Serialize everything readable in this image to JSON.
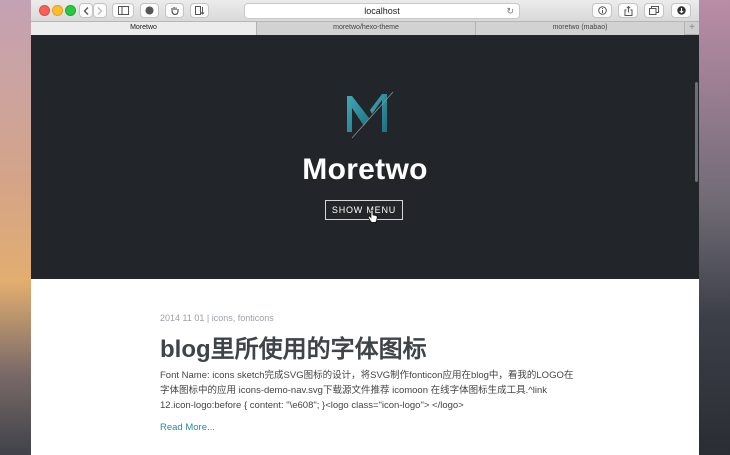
{
  "browser": {
    "address": "localhost",
    "tabs": [
      {
        "label": "Moretwo",
        "active": true
      },
      {
        "label": "moretwo/hexo-theme",
        "active": false
      },
      {
        "label": "moretwo (mabao)",
        "active": false
      }
    ],
    "new_tab_label": "+"
  },
  "hero": {
    "site_title": "Moretwo",
    "menu_button": "SHOW MENU",
    "background": "#222529",
    "accent": "#2a8a9a"
  },
  "post": {
    "date": "2014 11 01",
    "separator": "|",
    "tags": "icons, fonticons",
    "title": "blog里所使用的字体图标",
    "excerpt": "Font Name: icons sketch完成SVG图标的设计，将SVG制作fonticon应用在blog中，看我的LOGO在字体图标中的应用 icons-demo-nav.svg下载源文件推荐 icomoon 在线字体图标生成工具.^link 12.icon-logo:before { content: \"\\e608\"; }<logo class=\"icon-logo\"> </logo>",
    "read_more": "Read More..."
  }
}
